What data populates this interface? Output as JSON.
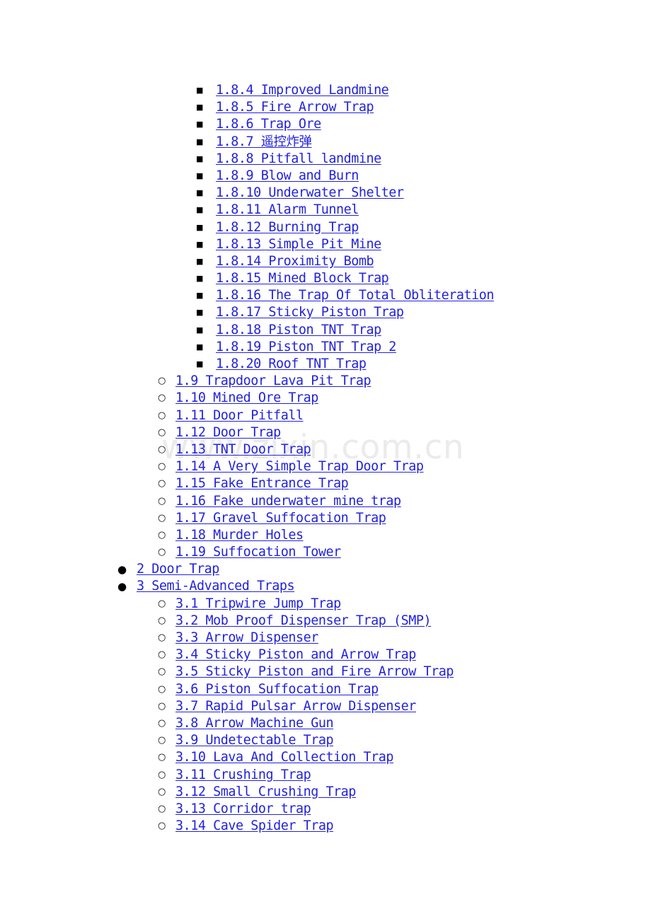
{
  "document": {
    "type": "table-of-contents",
    "link_color": "#2222dd",
    "text_background": "#ffffff"
  },
  "watermark": {
    "text": "www.zixin.com.cn",
    "color": "#ebebeb"
  },
  "bullets": {
    "level1": "filled-disc",
    "level2": "hollow-circle",
    "level3": "filled-square"
  },
  "toc": {
    "entries": [
      {
        "level": 3,
        "label": "1.8.4 Improved Landmine"
      },
      {
        "level": 3,
        "label": "1.8.5 Fire Arrow Trap"
      },
      {
        "level": 3,
        "label": "1.8.6 Trap Ore"
      },
      {
        "level": 3,
        "label": "1.8.7 遥控炸弹"
      },
      {
        "level": 3,
        "label": "1.8.8 Pitfall landmine"
      },
      {
        "level": 3,
        "label": "1.8.9 Blow and Burn"
      },
      {
        "level": 3,
        "label": "1.8.10 Underwater Shelter"
      },
      {
        "level": 3,
        "label": "1.8.11 Alarm Tunnel"
      },
      {
        "level": 3,
        "label": "1.8.12 Burning Trap"
      },
      {
        "level": 3,
        "label": "1.8.13 Simple Pit Mine"
      },
      {
        "level": 3,
        "label": "1.8.14 Proximity Bomb"
      },
      {
        "level": 3,
        "label": "1.8.15 Mined Block Trap"
      },
      {
        "level": 3,
        "label": "1.8.16 The Trap Of Total Obliteration"
      },
      {
        "level": 3,
        "label": "1.8.17 Sticky Piston Trap"
      },
      {
        "level": 3,
        "label": "1.8.18 Piston TNT Trap"
      },
      {
        "level": 3,
        "label": "1.8.19 Piston TNT Trap 2"
      },
      {
        "level": 3,
        "label": "1.8.20 Roof TNT Trap"
      },
      {
        "level": 2,
        "label": "1.9 Trapdoor Lava Pit Trap"
      },
      {
        "level": 2,
        "label": "1.10 Mined Ore Trap"
      },
      {
        "level": 2,
        "label": "1.11 Door Pitfall"
      },
      {
        "level": 2,
        "label": "1.12 Door Trap"
      },
      {
        "level": 2,
        "label": "1.13 TNT Door Trap"
      },
      {
        "level": 2,
        "label": "1.14 A Very Simple Trap Door Trap"
      },
      {
        "level": 2,
        "label": "1.15 Fake Entrance Trap"
      },
      {
        "level": 2,
        "label": "1.16 Fake underwater mine trap"
      },
      {
        "level": 2,
        "label": "1.17 Gravel Suffocation Trap"
      },
      {
        "level": 2,
        "label": "1.18 Murder Holes"
      },
      {
        "level": 2,
        "label": "1.19 Suffocation Tower"
      },
      {
        "level": 1,
        "label": "2 Door Trap"
      },
      {
        "level": 1,
        "label": "3 Semi-Advanced Traps"
      },
      {
        "level": 2,
        "label": "3.1 Tripwire Jump Trap"
      },
      {
        "level": 2,
        "label": "3.2 Mob Proof Dispenser Trap (SMP)"
      },
      {
        "level": 2,
        "label": "3.3 Arrow Dispenser"
      },
      {
        "level": 2,
        "label": "3.4 Sticky Piston and Arrow Trap"
      },
      {
        "level": 2,
        "label": "3.5 Sticky Piston and Fire Arrow Trap"
      },
      {
        "level": 2,
        "label": "3.6 Piston Suffocation Trap"
      },
      {
        "level": 2,
        "label": "3.7 Rapid Pulsar Arrow Dispenser"
      },
      {
        "level": 2,
        "label": "3.8 Arrow Machine Gun"
      },
      {
        "level": 2,
        "label": "3.9 Undetectable Trap"
      },
      {
        "level": 2,
        "label": "3.10 Lava And Collection Trap"
      },
      {
        "level": 2,
        "label": "3.11 Crushing Trap"
      },
      {
        "level": 2,
        "label": "3.12 Small Crushing Trap"
      },
      {
        "level": 2,
        "label": "3.13 Corridor trap"
      },
      {
        "level": 2,
        "label": "3.14 Cave Spider Trap"
      }
    ]
  }
}
